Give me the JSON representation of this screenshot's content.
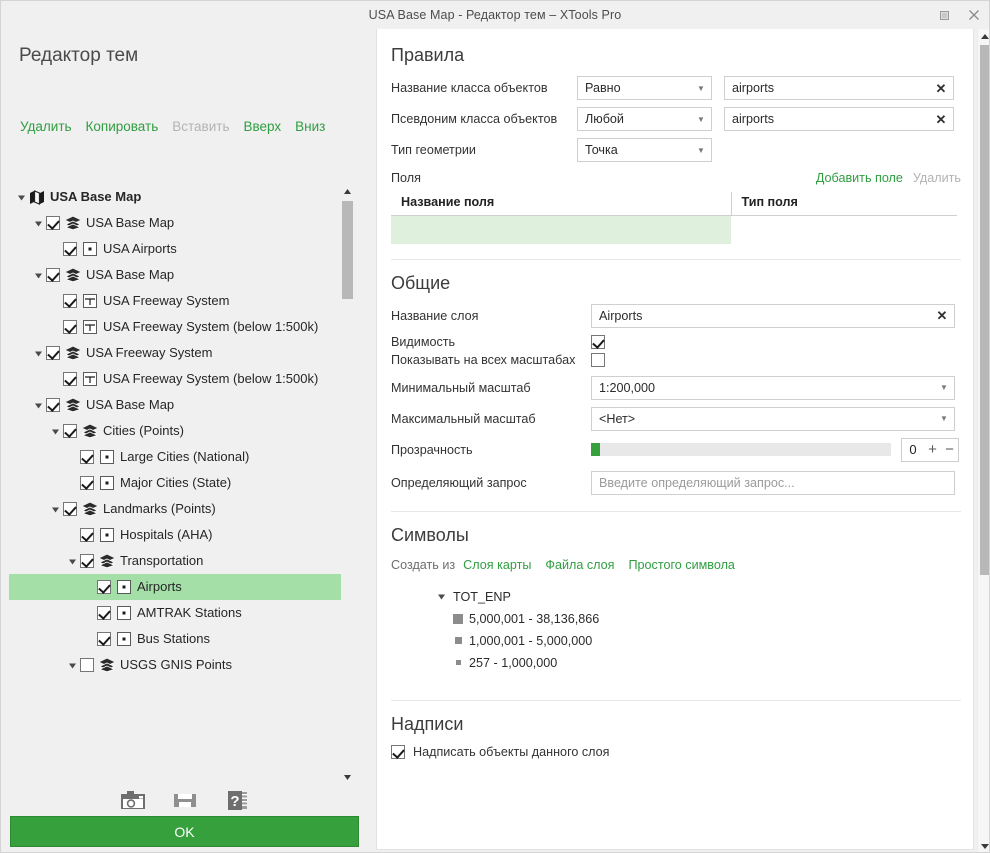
{
  "window": {
    "title": "USA Base Map - Редактор тем – XTools Pro",
    "restore_tooltip": "Свернуть в окно",
    "close_tooltip": "Закрыть"
  },
  "left": {
    "panel_title": "Редактор тем",
    "commands": [
      {
        "label": "Удалить",
        "disabled": false
      },
      {
        "label": "Копировать",
        "disabled": false
      },
      {
        "label": "Вставить",
        "disabled": true
      },
      {
        "label": "Вверх",
        "disabled": false
      },
      {
        "label": "Вниз",
        "disabled": false
      }
    ],
    "tree": [
      {
        "label": "USA Base Map",
        "indent": 0,
        "expander": "down",
        "checkbox": "none",
        "icon": "map-icon",
        "bold": true,
        "selected": false
      },
      {
        "label": "USA Base Map",
        "indent": 1,
        "expander": "down",
        "checkbox": "checked",
        "icon": "layers-icon",
        "bold": false,
        "selected": false
      },
      {
        "label": "USA Airports",
        "indent": 2,
        "expander": "none",
        "checkbox": "checked",
        "icon": "point-feature-icon",
        "bold": false,
        "selected": false
      },
      {
        "label": "USA Base Map",
        "indent": 1,
        "expander": "down",
        "checkbox": "checked",
        "icon": "layers-icon",
        "bold": false,
        "selected": false
      },
      {
        "label": "USA Freeway System",
        "indent": 2,
        "expander": "none",
        "checkbox": "checked",
        "icon": "line-feature-icon",
        "bold": false,
        "selected": false
      },
      {
        "label": "USA Freeway System (below 1:500k)",
        "indent": 2,
        "expander": "none",
        "checkbox": "checked",
        "icon": "line-feature-icon",
        "bold": false,
        "selected": false
      },
      {
        "label": "USA Freeway System",
        "indent": 1,
        "expander": "down",
        "checkbox": "checked",
        "icon": "layers-icon",
        "bold": false,
        "selected": false
      },
      {
        "label": "USA Freeway System (below 1:500k)",
        "indent": 2,
        "expander": "none",
        "checkbox": "checked",
        "icon": "line-feature-icon",
        "bold": false,
        "selected": false
      },
      {
        "label": "USA Base Map",
        "indent": 1,
        "expander": "down",
        "checkbox": "checked",
        "icon": "layers-icon",
        "bold": false,
        "selected": false
      },
      {
        "label": "Cities (Points)",
        "indent": 2,
        "expander": "down",
        "checkbox": "checked",
        "icon": "layers-icon",
        "bold": false,
        "selected": false
      },
      {
        "label": "Large Cities (National)",
        "indent": 3,
        "expander": "none",
        "checkbox": "checked",
        "icon": "point-feature-icon",
        "bold": false,
        "selected": false
      },
      {
        "label": "Major Cities (State)",
        "indent": 3,
        "expander": "none",
        "checkbox": "checked",
        "icon": "point-feature-icon",
        "bold": false,
        "selected": false
      },
      {
        "label": "Landmarks (Points)",
        "indent": 2,
        "expander": "down",
        "checkbox": "checked",
        "icon": "layers-icon",
        "bold": false,
        "selected": false
      },
      {
        "label": "Hospitals (AHA)",
        "indent": 3,
        "expander": "none",
        "checkbox": "checked",
        "icon": "point-feature-icon",
        "bold": false,
        "selected": false
      },
      {
        "label": "Transportation",
        "indent": 3,
        "expander": "down",
        "checkbox": "checked",
        "icon": "layers-icon",
        "bold": false,
        "selected": false
      },
      {
        "label": "Airports",
        "indent": 4,
        "expander": "none",
        "checkbox": "checked",
        "icon": "point-feature-icon",
        "bold": false,
        "selected": true
      },
      {
        "label": "AMTRAK Stations",
        "indent": 4,
        "expander": "none",
        "checkbox": "checked",
        "icon": "point-feature-icon",
        "bold": false,
        "selected": false
      },
      {
        "label": "Bus Stations",
        "indent": 4,
        "expander": "none",
        "checkbox": "checked",
        "icon": "point-feature-icon",
        "bold": false,
        "selected": false
      },
      {
        "label": "USGS GNIS Points",
        "indent": 3,
        "expander": "down",
        "checkbox": "unchecked",
        "icon": "layers-icon",
        "bold": false,
        "selected": false
      }
    ],
    "toolbar_icons": [
      {
        "name": "camera-icon"
      },
      {
        "name": "save-icon"
      },
      {
        "name": "help-icon"
      }
    ],
    "ok_label": "OK"
  },
  "rules": {
    "heading": "Правила",
    "feature_class_name_label": "Название класса объектов",
    "feature_class_name_operator": "Равно",
    "feature_class_name_value": "airports",
    "feature_class_alias_label": "Псевдоним класса объектов",
    "feature_class_alias_operator": "Любой",
    "feature_class_alias_value": "airports",
    "geometry_type_label": "Тип геометрии",
    "geometry_type_value": "Точка",
    "fields_label": "Поля",
    "add_field_link": "Добавить поле",
    "delete_field_link": "Удалить",
    "fields_table": {
      "columns": [
        "Название поля",
        "Тип поля"
      ],
      "rows": [
        {
          "field_name": "",
          "field_type": ""
        }
      ]
    }
  },
  "general": {
    "heading": "Общие",
    "layer_name_label": "Название слоя",
    "layer_name_value": "Airports",
    "visibility_label": "Видимость",
    "visibility_checked": true,
    "show_all_scales_label": "Показывать на всех масштабах",
    "show_all_scales_checked": false,
    "min_scale_label": "Минимальный масштаб",
    "min_scale_value": "1:200,000",
    "max_scale_label": "Максимальный масштаб",
    "max_scale_value": "<Нет>",
    "transparency_label": "Прозрачность",
    "transparency_value": "0",
    "transparency_percent": 3,
    "definition_query_label": "Определяющий запрос",
    "definition_query_value": "",
    "definition_query_placeholder": "Введите определяющий запрос..."
  },
  "symbols": {
    "heading": "Символы",
    "create_from_label": "Создать из",
    "create_from_links": [
      "Слоя карты",
      "Файла слоя",
      "Простого символа"
    ],
    "renderer_field": "TOT_ENP",
    "classes": [
      {
        "label": "5,000,001 - 38,136,866",
        "swatch_size": 10,
        "swatch_color": "#8c8c8c"
      },
      {
        "label": "1,000,001 - 5,000,000",
        "swatch_size": 7,
        "swatch_color": "#8c8c8c"
      },
      {
        "label": "257 - 1,000,000",
        "swatch_size": 5,
        "swatch_color": "#8c8c8c"
      }
    ]
  },
  "labels": {
    "heading": "Надписи",
    "label_features_text": "Надписать объекты данного слоя",
    "label_features_checked": true
  },
  "colors": {
    "accent_green": "#2f9e41",
    "ok_green": "#35a03c",
    "selection_green": "#a5dfa8",
    "field_row_green": "#dff0dd",
    "chrome": "#f0f0f0"
  }
}
